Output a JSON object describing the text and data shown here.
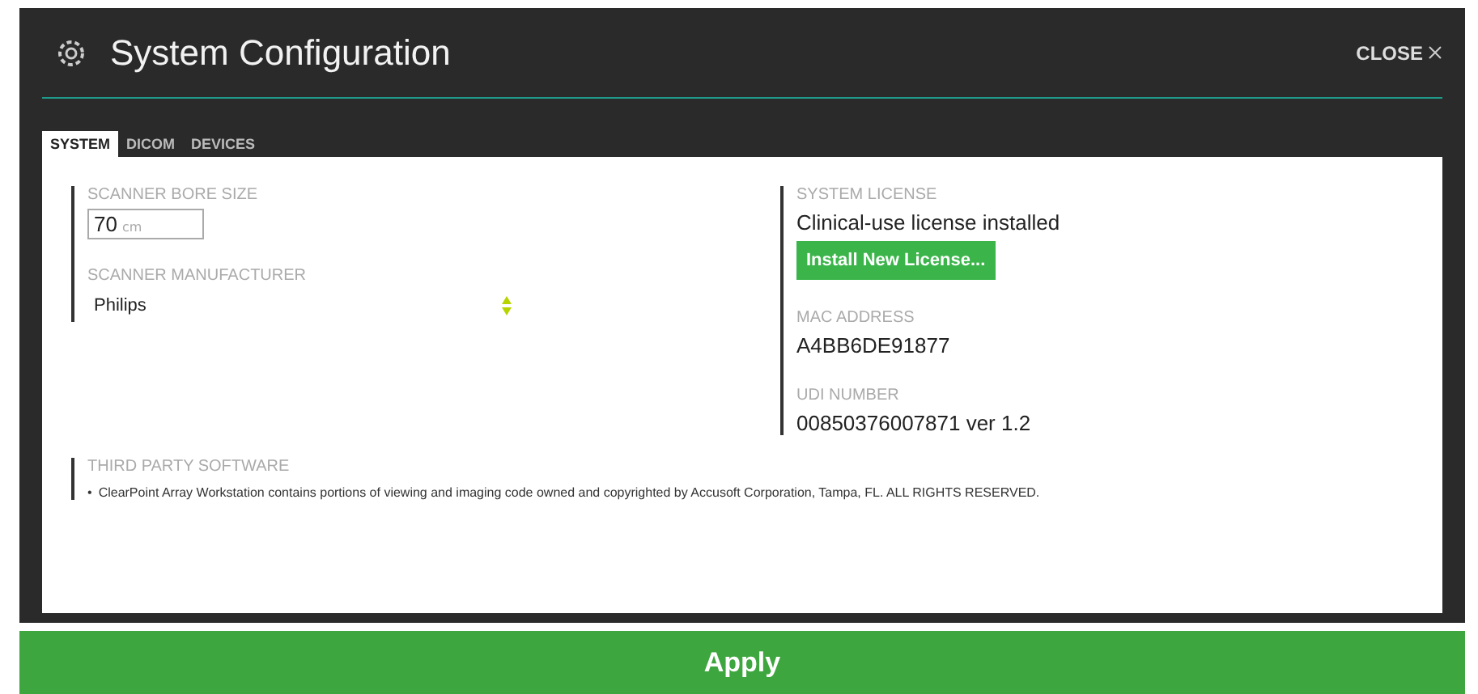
{
  "window": {
    "title": "System Configuration",
    "close": "CLOSE"
  },
  "tabs": [
    {
      "label": "SYSTEM",
      "selected": true
    },
    {
      "label": "DICOM",
      "selected": false
    },
    {
      "label": "DEVICES",
      "selected": false
    }
  ],
  "left": {
    "bore_label": "SCANNER BORE SIZE",
    "bore_value": "70",
    "bore_unit": "cm",
    "manufacturer_label": "SCANNER MANUFACTURER",
    "manufacturer_value": "Philips"
  },
  "right": {
    "license_label": "SYSTEM LICENSE",
    "license_value": "Clinical-use license installed",
    "install_button": "Install New License...",
    "mac_label": "MAC ADDRESS",
    "mac_value": "A4BB6DE91877",
    "udi_label": "UDI NUMBER",
    "udi_value": "00850376007871 ver 1.2"
  },
  "third_party": {
    "label": "THIRD PARTY SOFTWARE",
    "bullet": "•",
    "text": "ClearPoint Array Workstation contains portions of viewing and imaging code owned and copyrighted by Accusoft Corporation, Tampa, FL. ALL RIGHTS RESERVED."
  },
  "apply_button": "Apply"
}
